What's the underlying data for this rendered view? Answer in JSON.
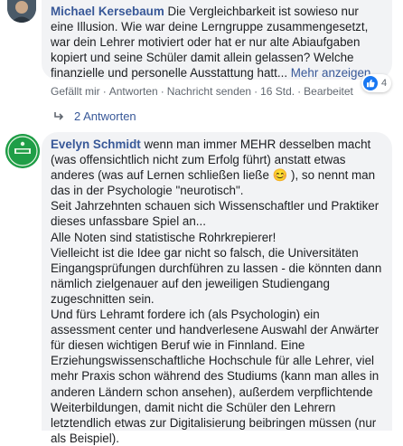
{
  "comment1": {
    "author": "Michael Kersebaum",
    "text": " Die Vergleichbarkeit ist sowieso nur eine Illusion. Wie war deine Lerngruppe zusammengesetzt, war dein Lehrer motiviert oder hat er nur alte Abiaufgaben kopiert und seine Schüler damit allein gelassen? Welche finanzielle und personelle Ausstattung hatt... ",
    "more_link": "Mehr anzeigen",
    "actions": {
      "like": "Gefällt mir",
      "reply": "Antworten",
      "message": "Nachricht senden",
      "time": "16 Std.",
      "edited": "Bearbeitet"
    },
    "reactions": {
      "count": "4",
      "icon": "like-icon"
    },
    "replies_label": "2 Antworten"
  },
  "comment2": {
    "author": "Evelyn Schmidt",
    "text": " wenn man immer MEHR desselben macht (was offensichtlich nicht zum Erfolg führt) anstatt etwas anderes (was auf Lernen schließen ließe 😊 ), so nennt man das in der Psychologie \"neurotisch\".\nSeit Jahrzehnten schauen sich Wissenschaftler und Praktiker dieses unfassbare Spiel an...\nAlle Noten sind statistische Rohrkrepierer!\nVielleicht ist die Idee gar nicht so falsch, die Universitäten Eingangsprüfungen durchführen zu lassen - die könnten dann nämlich zielgenauer auf den jeweiligen Studiengang zugeschnitten sein.\nUnd fürs Lehramt fordere ich (als Psychologin) ein assessment center und handverlesene Auswahl der Anwärter für diesen wichtigen Beruf wie in Finnland. Eine Erziehungswissenschaftliche Hochschule für alle Lehrer, viel mehr Praxis schon während des Studiums (kann man alles in anderen Ländern schon ansehen), außerdem verpflichtende Weiterbildungen, damit nicht die Schüler den Lehrern letztendlich etwas zur Digitalisierung beibringen müssen (nur als Beispiel)."
  },
  "colors": {
    "link": "#385898",
    "bubble": "#f2f3f5",
    "meta": "#606770",
    "like_blue": "#1877f2"
  }
}
